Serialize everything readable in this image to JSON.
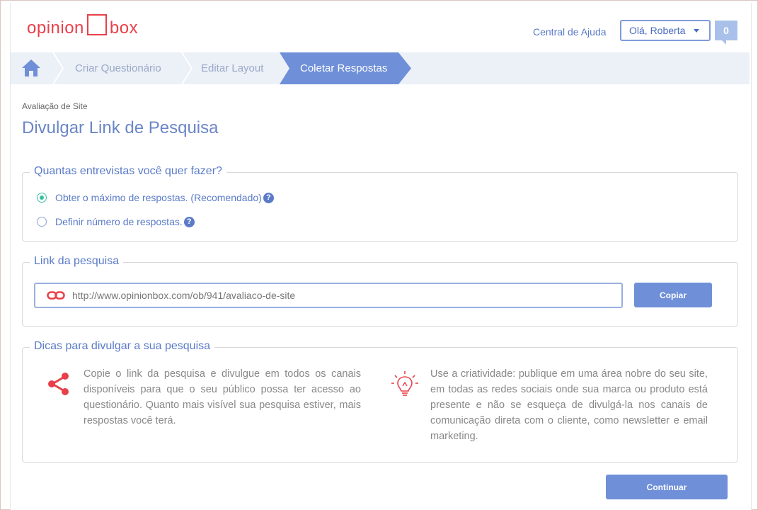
{
  "header": {
    "logo_part1": "opinion",
    "logo_part2": "box",
    "help_link": "Central de Ajuda",
    "user_greeting": "Olá, Roberta",
    "notification_count": "0"
  },
  "breadcrumb": {
    "steps": [
      "Criar Questionário",
      "Editar Layout",
      "Coletar Respostas"
    ],
    "active_index": 2
  },
  "page": {
    "survey_name": "Avaliação de Site",
    "title": "Divulgar Link de Pesquisa"
  },
  "interviews": {
    "legend": "Quantas entrevistas você quer fazer?",
    "options": [
      {
        "label": "Obter o máximo de respostas. (Recomendado)",
        "selected": true
      },
      {
        "label": "Definir número de respostas.",
        "selected": false
      }
    ],
    "help_glyph": "?"
  },
  "link": {
    "legend": "Link da pesquisa",
    "url": "http://www.opinionbox.com/ob/941/avaliaco-de-site",
    "copy_label": "Copiar"
  },
  "tips": {
    "legend": "Dicas para divulgar a sua pesquisa",
    "items": [
      {
        "icon": "share-icon",
        "text": "Copie o link da pesquisa e divulgue em todos os canais disponíveis para que o seu público possa ter acesso ao questionário. Quanto mais visível sua pesquisa estiver, mais respostas você terá."
      },
      {
        "icon": "lightbulb-icon",
        "text": "Use a criatividade: publique em uma área nobre do seu site, em todas as redes sociais onde sua marca ou produto está presente e não se esqueça de divulgá-la nos canais de comunicação direta com o cliente, como newsletter e email marketing."
      }
    ]
  },
  "footer": {
    "continue_label": "Continuar"
  },
  "colors": {
    "brand_red": "#e8404a",
    "accent_blue": "#6f8fd8",
    "radio_green": "#3bbfa0"
  }
}
